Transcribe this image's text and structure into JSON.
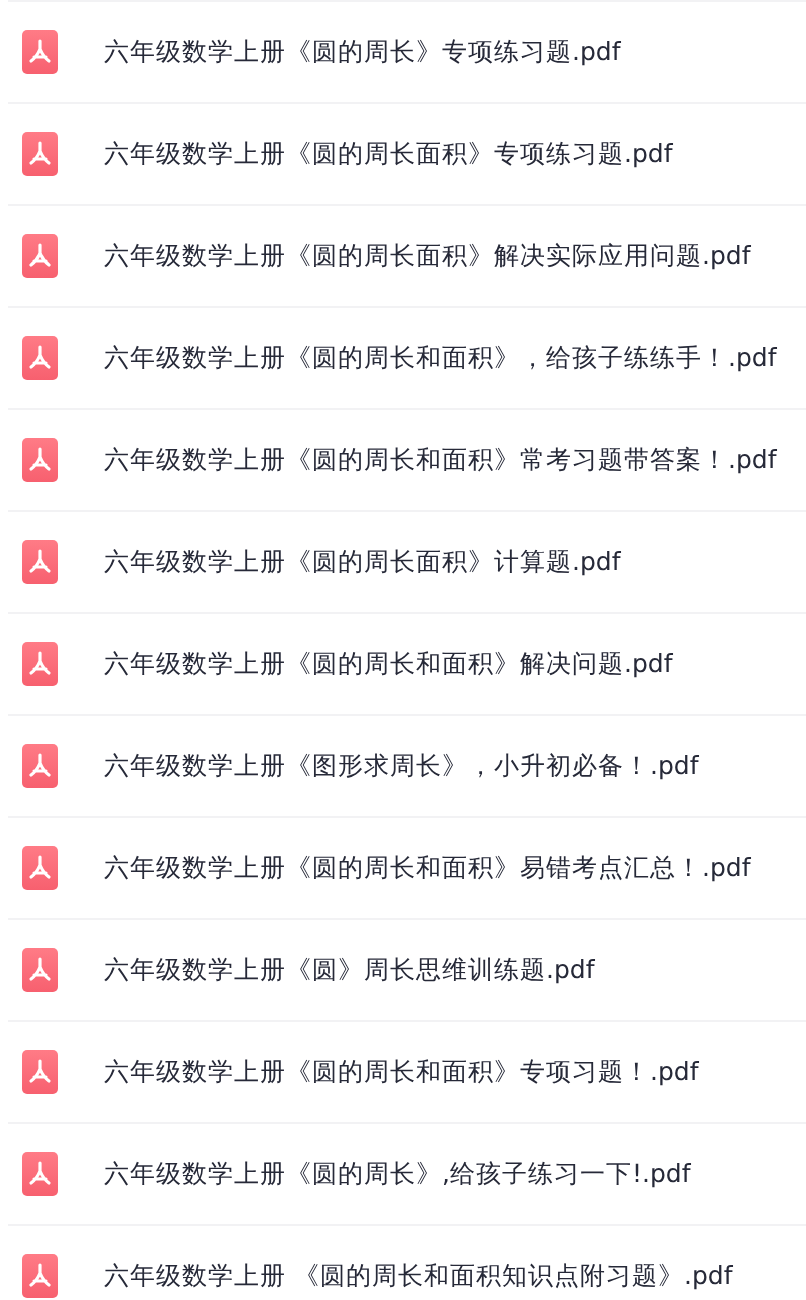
{
  "files": [
    {
      "name": "六年级数学上册《圆的周长》专项练习题.pdf"
    },
    {
      "name": "六年级数学上册《圆的周长面积》专项练习题.pdf"
    },
    {
      "name": "六年级数学上册《圆的周长面积》解决实际应用问题.pdf"
    },
    {
      "name": "六年级数学上册《圆的周长和面积》，给孩子练练手！.pdf"
    },
    {
      "name": "六年级数学上册《圆的周长和面积》常考习题带答案！.pdf"
    },
    {
      "name": "六年级数学上册《圆的周长面积》计算题.pdf"
    },
    {
      "name": "六年级数学上册《圆的周长和面积》解决问题.pdf"
    },
    {
      "name": "六年级数学上册《图形求周长》，小升初必备！.pdf"
    },
    {
      "name": "六年级数学上册《圆的周长和面积》易错考点汇总！.pdf"
    },
    {
      "name": "六年级数学上册《圆》周长思维训练题.pdf"
    },
    {
      "name": "六年级数学上册《圆的周长和面积》专项习题！.pdf"
    },
    {
      "name": "六年级数学上册《圆的周长》,给孩子练习一下!.pdf"
    },
    {
      "name": "六年级数学上册 《圆的周长和面积知识点附习题》.pdf"
    }
  ]
}
